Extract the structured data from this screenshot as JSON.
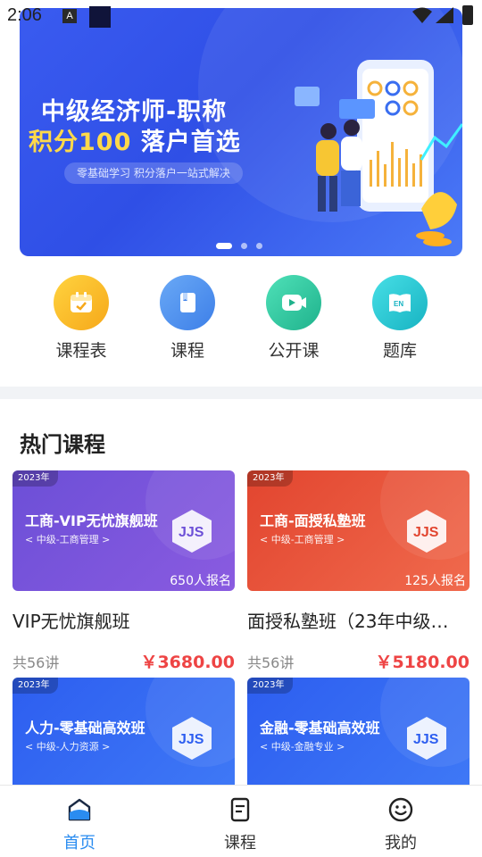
{
  "status_bar": {
    "time": "2:06",
    "a_badge": "A"
  },
  "banner": {
    "title_line1": "中级经济师-职称",
    "title_line2_a": "积分100",
    "title_line2_b": "落户首选",
    "subtitle": "零基础学习 积分落户一站式解决",
    "page_count": 3,
    "active_page": 1
  },
  "quick_menu": [
    {
      "label": "课程表",
      "icon": "calendar-icon",
      "color": "#f9b915"
    },
    {
      "label": "课程",
      "icon": "book-icon",
      "color": "#4f8ff2"
    },
    {
      "label": "公开课",
      "icon": "video-icon",
      "color": "#2fc7a1"
    },
    {
      "label": "题库",
      "icon": "question-bank-icon",
      "color": "#28c3cf"
    }
  ],
  "hot": {
    "title": "热门课程",
    "courses": [
      {
        "year": "2023年",
        "thumb_title": "工商-VIP无忧旗舰班",
        "thumb_sub": "< 中级-工商管理 >",
        "logo": "JJS",
        "enroll": "650人报名",
        "name": "VIP无忧旗舰班",
        "lessons": "共56讲",
        "price": "￥3680.00"
      },
      {
        "year": "2023年",
        "thumb_title": "工商-面授私塾班",
        "thumb_sub": "< 中级-工商管理 >",
        "logo": "JJS",
        "enroll": "125人报名",
        "name": "面授私塾班（23年中级…",
        "lessons": "共56讲",
        "price": "￥5180.00"
      },
      {
        "year": "2023年",
        "thumb_title": "人力-零基础高效班",
        "thumb_sub": "< 中级-人力资源 >",
        "logo": "JJS"
      },
      {
        "year": "2023年",
        "thumb_title": "金融-零基础高效班",
        "thumb_sub": "< 中级-金融专业 >",
        "logo": "JJS"
      }
    ]
  },
  "tabbar": [
    {
      "label": "首页",
      "icon": "home-icon",
      "active": true
    },
    {
      "label": "课程",
      "icon": "course-list-icon",
      "active": false
    },
    {
      "label": "我的",
      "icon": "smile-profile-icon",
      "active": false
    }
  ],
  "colors": {
    "accent": "#2a8cf0",
    "price": "#ee4444"
  }
}
